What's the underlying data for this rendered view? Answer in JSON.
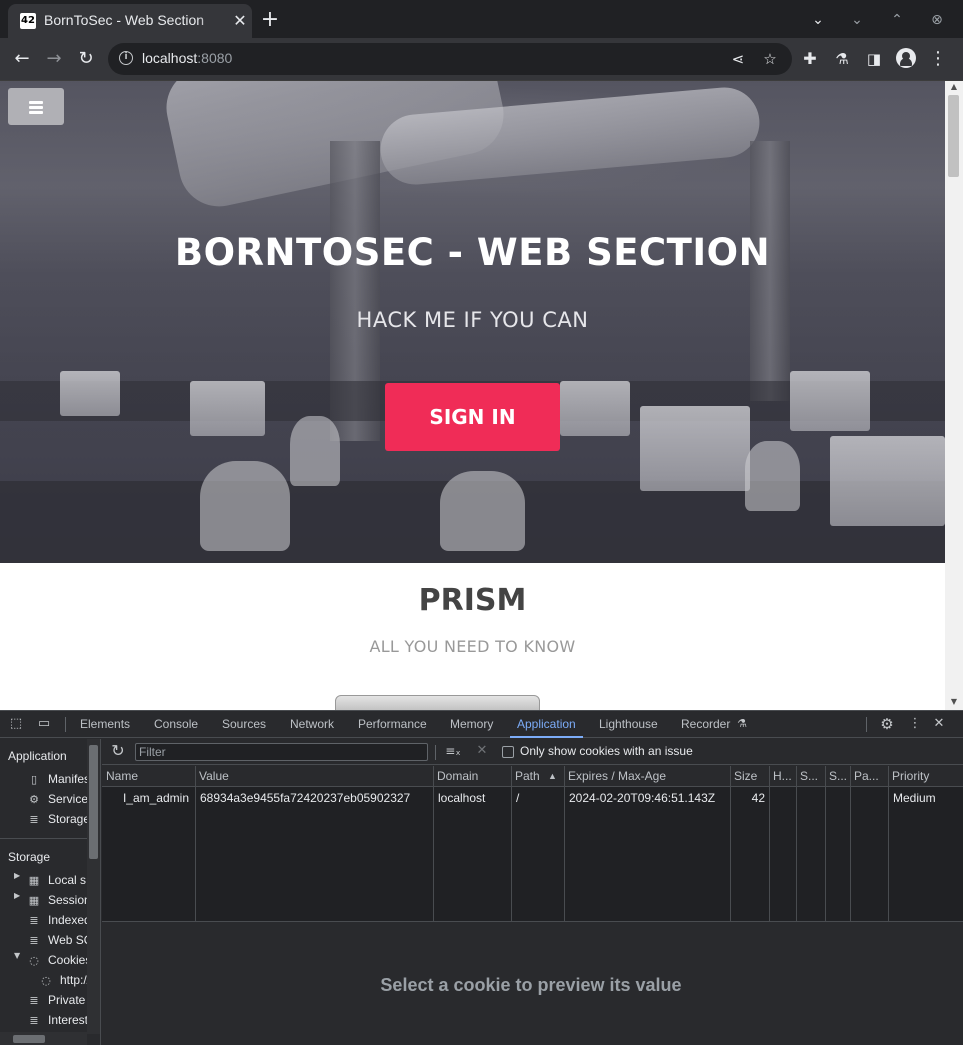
{
  "browser": {
    "tab_title": "BornToSec - Web Section",
    "tab_favicon": "42",
    "url_host": "localhost",
    "url_port": ":8080"
  },
  "page": {
    "hero_title": "BORNTOSEC - WEB SECTION",
    "hero_subtitle": "HACK ME IF YOU CAN",
    "signin_label": "SIGN IN",
    "section_title": "PRISM",
    "section_subtitle": "ALL YOU NEED TO KNOW",
    "accent_color": "#f02c57"
  },
  "devtools": {
    "tabs": [
      "Elements",
      "Console",
      "Sources",
      "Network",
      "Performance",
      "Memory",
      "Application",
      "Lighthouse",
      "Recorder"
    ],
    "active_tab": "Application",
    "sidebar": {
      "application_heading": "Application",
      "application_items": [
        "Manifest",
        "Service",
        "Storage"
      ],
      "storage_heading": "Storage",
      "storage_items": [
        "Local s",
        "Session",
        "IndexedDB",
        "Web SQL",
        "Cookies",
        "http://",
        "Private",
        "Interest"
      ]
    },
    "filter_placeholder": "Filter",
    "only_issue_label": "Only show cookies with an issue",
    "columns": [
      "Name",
      "Value",
      "Domain",
      "Path",
      "Expires / Max-Age",
      "Size",
      "H...",
      "S...",
      "S...",
      "Pa...",
      "Priority"
    ],
    "cookie": {
      "name": "I_am_admin",
      "value": "68934a3e9455fa72420237eb05902327",
      "domain": "localhost",
      "path": "/",
      "expires": "2024-02-20T09:46:51.143Z",
      "size": "42",
      "priority": "Medium"
    },
    "preview_text": "Select a cookie to preview its value",
    "accent_color": "#7cacf8"
  }
}
